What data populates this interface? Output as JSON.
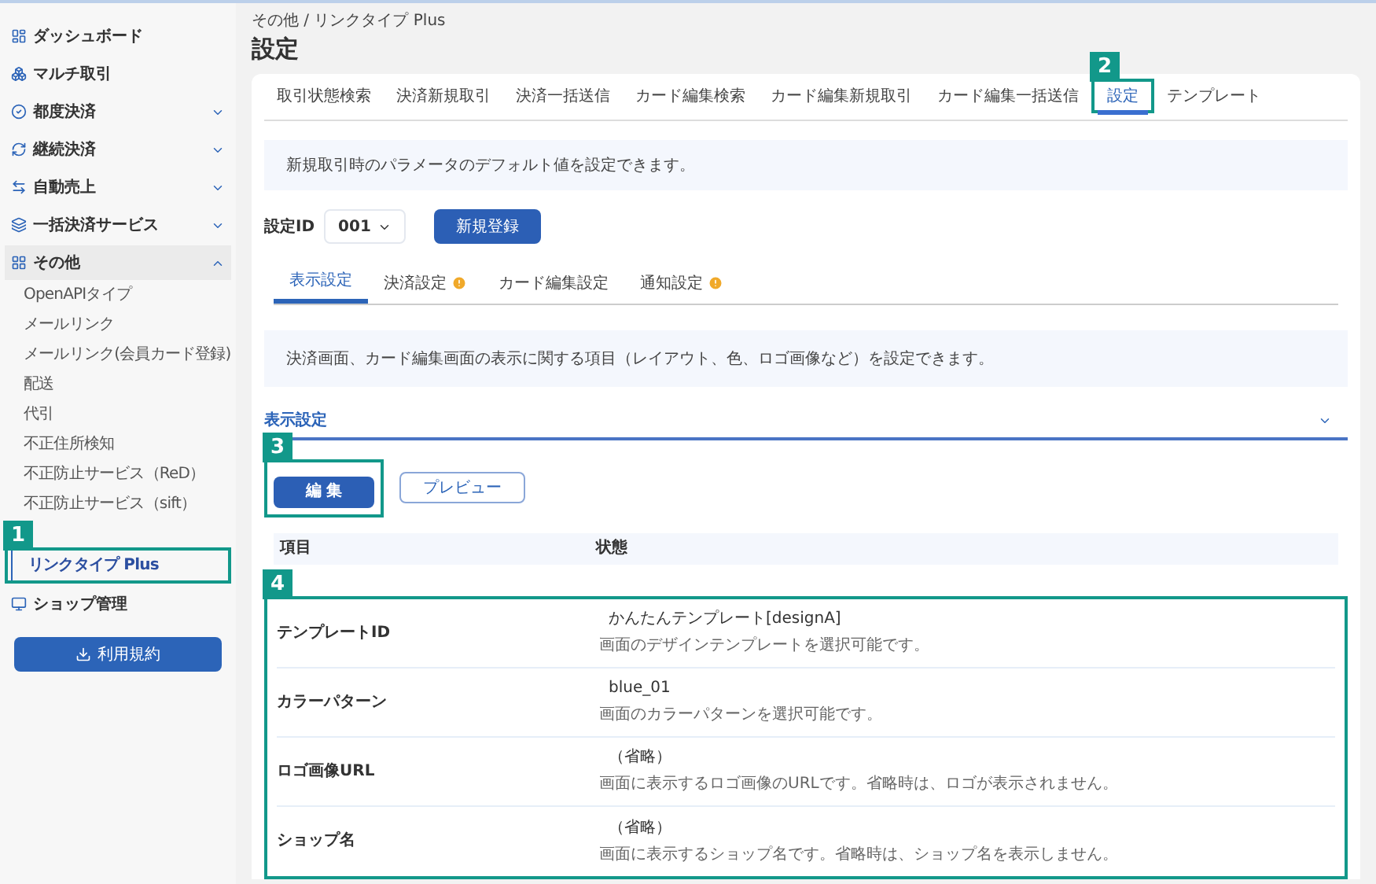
{
  "sidebar": {
    "items": [
      {
        "label": "ダッシュボード"
      },
      {
        "label": "マルチ取引"
      },
      {
        "label": "都度決済",
        "expanded": false
      },
      {
        "label": "継続決済",
        "expanded": false
      },
      {
        "label": "自動売上",
        "expanded": false
      },
      {
        "label": "一括決済サービス",
        "expanded": false
      },
      {
        "label": "その他",
        "expanded": true,
        "children": [
          {
            "label": "OpenAPIタイプ",
            "selected": false
          },
          {
            "label": "メールリンク",
            "selected": false
          },
          {
            "label": "メールリンク(会員カード登録)",
            "selected": false
          },
          {
            "label": "配送",
            "selected": false
          },
          {
            "label": "代引",
            "selected": false
          },
          {
            "label": "不正住所検知",
            "selected": false
          },
          {
            "label": "不正防止サービス（ReD）",
            "selected": false
          },
          {
            "label": "不正防止サービス（sift）",
            "selected": false
          },
          {
            "label": "リンクタイプ Plus",
            "selected": true,
            "callout": "1"
          }
        ]
      },
      {
        "label": "ショップ管理"
      }
    ],
    "button": "利用規約"
  },
  "breadcrumb": "その他 / リンクタイプ Plus",
  "page_title": "設定",
  "tabs": [
    {
      "label": "取引状態検索",
      "selected": false
    },
    {
      "label": "決済新規取引",
      "selected": false
    },
    {
      "label": "決済一括送信",
      "selected": false
    },
    {
      "label": "カード編集検索",
      "selected": false
    },
    {
      "label": "カード編集新規取引",
      "selected": false
    },
    {
      "label": "カード編集一括送信",
      "selected": false
    },
    {
      "label": "設定",
      "selected": true,
      "callout": "2"
    },
    {
      "label": "テンプレート",
      "selected": false
    }
  ],
  "info": "新規取引時のパラメータのデフォルト値を設定できます。",
  "setting_id": {
    "label": "設定ID",
    "value": "001",
    "button": "新規登録"
  },
  "sub_tabs": [
    {
      "label": "表示設定",
      "selected": true,
      "warning": false
    },
    {
      "label": "決済設定",
      "selected": false,
      "warning": true
    },
    {
      "label": "カード編集設定",
      "selected": false,
      "warning": false
    },
    {
      "label": "通知設定",
      "selected": false,
      "warning": true
    }
  ],
  "sub_info": "決済画面、カード編集画面の表示に関する項目（レイアウト、色、ロゴ画像など）を設定できます。",
  "section": {
    "title": "表示設定",
    "expanded": true
  },
  "actions": {
    "edit": "編 集",
    "edit_callout": "3",
    "preview": "プレビュー"
  },
  "table": {
    "columns": [
      "項目",
      "状態"
    ],
    "callout": "4",
    "rows": [
      {
        "item": "テンプレートID",
        "value": "かんたんテンプレート[designA]",
        "note": "画面のデザインテンプレートを選択可能です。"
      },
      {
        "item": "カラーパターン",
        "value": "blue_01",
        "note": "画面のカラーパターンを選択可能です。"
      },
      {
        "item": "ロゴ画像URL",
        "value": "（省略）",
        "note": "画面に表示するロゴ画像のURLです。省略時は、ロゴが表示されません。"
      },
      {
        "item": "ショップ名",
        "value": "（省略）",
        "note": "画面に表示するショップ名です。省略時は、ショップ名を表示しません。"
      }
    ]
  }
}
